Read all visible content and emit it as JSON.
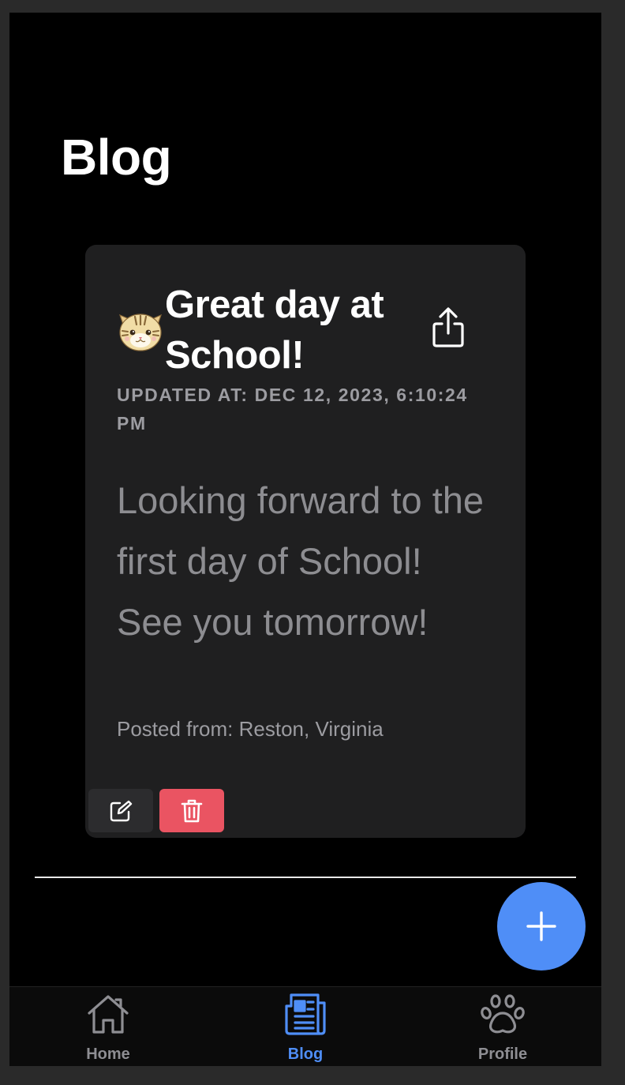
{
  "page": {
    "title": "Blog"
  },
  "post": {
    "title": "Great day at School!",
    "updated": "UPDATED AT: DEC 12, 2023, 6:10:24 PM",
    "body": "Looking forward to the first day of School! See you tomorrow!",
    "location": "Posted from: Reston, Virginia",
    "avatar_icon": "cat-face-icon",
    "share_icon": "share-icon",
    "edit_icon": "edit-icon",
    "delete_icon": "trash-icon"
  },
  "fab": {
    "icon": "plus-icon"
  },
  "tabbar": {
    "tabs": [
      {
        "label": "Home",
        "icon": "home-icon",
        "active": false
      },
      {
        "label": "Blog",
        "icon": "newspaper-icon",
        "active": true
      },
      {
        "label": "Profile",
        "icon": "paw-icon",
        "active": false
      }
    ]
  },
  "colors": {
    "accent": "#4f8ef7",
    "delete": "#ea5462",
    "card_bg": "#1f1f20",
    "background": "#000000"
  }
}
